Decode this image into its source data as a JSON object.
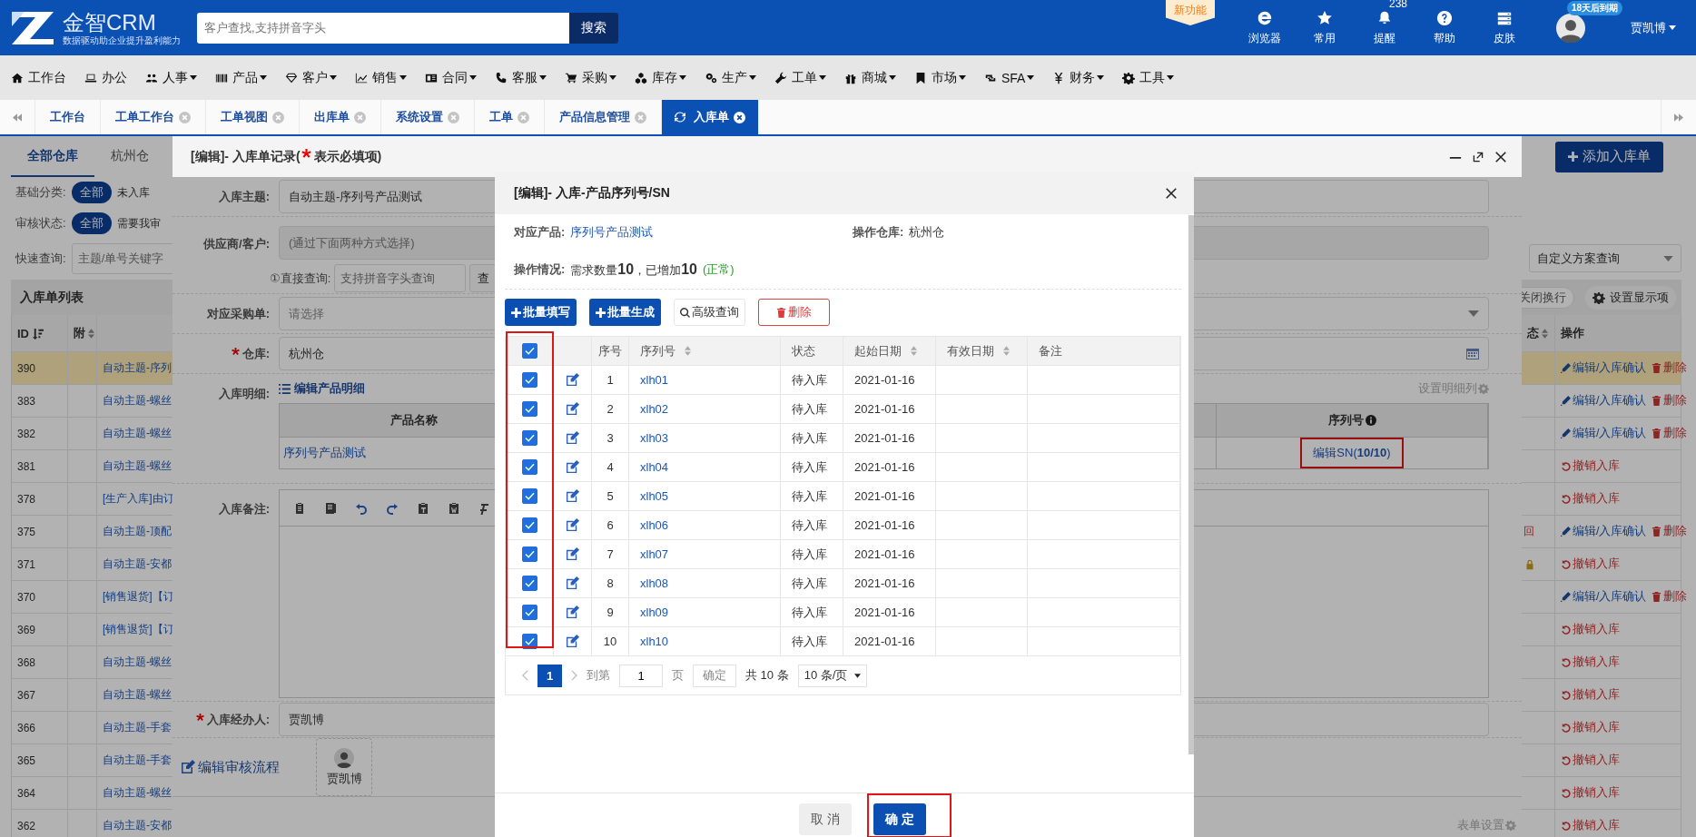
{
  "header": {
    "brand": "金智CRM",
    "tagline": "数据驱动助企业提升盈利能力",
    "search": {
      "placeholder": "客户查找,支持拼音字头"
    },
    "search_button": "搜索",
    "new_feature_badge": "新功能",
    "tools": [
      {
        "label": "浏览器"
      },
      {
        "label": "常用"
      },
      {
        "label": "提醒",
        "badge": "238"
      },
      {
        "label": "帮助"
      },
      {
        "label": "皮肤"
      }
    ],
    "user": {
      "expiry_badge": "18天后到期",
      "name": "贾凯博"
    }
  },
  "menu": [
    {
      "label": "工作台",
      "dropdown": false
    },
    {
      "label": "办公",
      "dropdown": false
    },
    {
      "label": "人事",
      "dropdown": true
    },
    {
      "label": "产品",
      "dropdown": true
    },
    {
      "label": "客户",
      "dropdown": true
    },
    {
      "label": "销售",
      "dropdown": true
    },
    {
      "label": "合同",
      "dropdown": true
    },
    {
      "label": "客服",
      "dropdown": true
    },
    {
      "label": "采购",
      "dropdown": true
    },
    {
      "label": "库存",
      "dropdown": true
    },
    {
      "label": "生产",
      "dropdown": true
    },
    {
      "label": "工单",
      "dropdown": true
    },
    {
      "label": "商城",
      "dropdown": true
    },
    {
      "label": "市场",
      "dropdown": true
    },
    {
      "label": "SFA",
      "dropdown": true
    },
    {
      "label": "财务",
      "dropdown": true
    },
    {
      "label": "工具",
      "dropdown": true
    }
  ],
  "tabs": [
    {
      "label": "工作台",
      "closable": false,
      "selected": false
    },
    {
      "label": "工单工作台",
      "closable": true,
      "selected": false
    },
    {
      "label": "工单视图",
      "closable": true,
      "selected": false
    },
    {
      "label": "出库单",
      "closable": true,
      "selected": false
    },
    {
      "label": "系统设置",
      "closable": true,
      "selected": false
    },
    {
      "label": "工单",
      "closable": true,
      "selected": false
    },
    {
      "label": "产品信息管理",
      "closable": true,
      "selected": false
    },
    {
      "label": "入库单",
      "closable": true,
      "selected": true
    }
  ],
  "page": {
    "warehouse_tabs": [
      {
        "label": "全部仓库",
        "selected": true
      },
      {
        "label": "杭州仓",
        "selected": false
      }
    ],
    "add_button": "添加入库单",
    "filters": [
      {
        "label": "基础分类:",
        "options": [
          {
            "label": "全部",
            "selected": true
          },
          {
            "label": "未入库",
            "selected": false
          }
        ]
      },
      {
        "label": "审核状态:",
        "options": [
          {
            "label": "全部",
            "selected": true
          },
          {
            "label": "需要我审",
            "selected": false
          }
        ]
      }
    ],
    "quick_search": {
      "label": "快速查询:",
      "placeholder": "主题/单号关键字"
    },
    "custom_query": {
      "value": "自定义方案查询"
    },
    "list_title": "入库单列表",
    "wrap_toggle": {
      "label": "关闭换行",
      "on": false
    },
    "display_settings_button": "设置显示项",
    "columns": [
      {
        "label": "ID",
        "sortable": true,
        "sorted_descending": true
      },
      {
        "label": "附",
        "sortable": true,
        "sorted_descending": false
      },
      {
        "label": "态",
        "sortable": true,
        "sorted_descending": false
      },
      {
        "label": "操作",
        "sortable": false,
        "sorted_descending": false
      }
    ],
    "rows": [
      {
        "id": "390",
        "subject": "自动主题-序列",
        "selected": true,
        "locked": false,
        "actions": [
          {
            "kind": "edit",
            "label": "编辑/入库确认"
          },
          {
            "kind": "delete",
            "label": "删除"
          }
        ]
      },
      {
        "id": "383",
        "subject": "自动主题-螺丝",
        "selected": false,
        "locked": false,
        "actions": [
          {
            "kind": "edit",
            "label": "编辑/入库确认"
          },
          {
            "kind": "delete",
            "label": "删除"
          }
        ]
      },
      {
        "id": "382",
        "subject": "自动主题-螺丝",
        "selected": false,
        "locked": false,
        "actions": [
          {
            "kind": "edit",
            "label": "编辑/入库确认"
          },
          {
            "kind": "delete",
            "label": "删除"
          }
        ]
      },
      {
        "id": "381",
        "subject": "自动主题-螺丝",
        "selected": false,
        "locked": false,
        "actions": [
          {
            "kind": "revoke",
            "label": "撤销入库"
          }
        ]
      },
      {
        "id": "378",
        "subject": "[生产入库]由订",
        "selected": false,
        "locked": false,
        "actions": [
          {
            "kind": "revoke",
            "label": "撤销入库"
          }
        ]
      },
      {
        "id": "375",
        "subject": "自动主题-顶配",
        "status": "回",
        "selected": false,
        "locked": false,
        "actions": [
          {
            "kind": "edit",
            "label": "编辑/入库确认"
          },
          {
            "kind": "delete",
            "label": "删除"
          }
        ]
      },
      {
        "id": "371",
        "subject": "自动主题-安都",
        "selected": false,
        "locked": true,
        "actions": [
          {
            "kind": "revoke",
            "label": "撤销入库"
          }
        ]
      },
      {
        "id": "370",
        "subject": "[销售退货]【订",
        "selected": false,
        "locked": false,
        "actions": [
          {
            "kind": "edit",
            "label": "编辑/入库确认"
          },
          {
            "kind": "delete",
            "label": "删除"
          }
        ]
      },
      {
        "id": "369",
        "subject": "[销售退货]【订",
        "selected": false,
        "locked": false,
        "actions": [
          {
            "kind": "revoke",
            "label": "撤销入库"
          }
        ]
      },
      {
        "id": "368",
        "subject": "自动主题-螺丝",
        "selected": false,
        "locked": false,
        "actions": [
          {
            "kind": "revoke",
            "label": "撤销入库"
          }
        ]
      },
      {
        "id": "367",
        "subject": "自动主题-螺丝",
        "selected": false,
        "locked": false,
        "actions": [
          {
            "kind": "revoke",
            "label": "撤销入库"
          }
        ]
      },
      {
        "id": "366",
        "subject": "自动主题-手套",
        "selected": false,
        "locked": false,
        "actions": [
          {
            "kind": "revoke",
            "label": "撤销入库"
          }
        ]
      },
      {
        "id": "365",
        "subject": "自动主题-手套",
        "selected": false,
        "locked": false,
        "actions": [
          {
            "kind": "revoke",
            "label": "撤销入库"
          }
        ]
      },
      {
        "id": "364",
        "subject": "自动主题-螺丝",
        "selected": false,
        "locked": false,
        "actions": [
          {
            "kind": "revoke",
            "label": "撤销入库"
          }
        ]
      },
      {
        "id": "362",
        "subject": "自动主题-安都",
        "selected": false,
        "locked": false,
        "actions": [
          {
            "kind": "revoke",
            "label": "撤销入库"
          }
        ]
      }
    ]
  },
  "record_dialog": {
    "title": "[编辑]- 入库单记录(",
    "title_note": "表示必填项)",
    "subject": {
      "label": "入库主题:",
      "required": false,
      "value": "自动主题-序列号产品测试"
    },
    "supplier": {
      "label": "供应商/客户:",
      "required": false,
      "placeholder": "(通过下面两种方式选择)"
    },
    "direct_query": {
      "label": "①直接查询:",
      "placeholder": "支持拼音字头查询",
      "button": "查"
    },
    "purchase_order": {
      "label": "对应采购单:",
      "required": false,
      "placeholder": "请选择"
    },
    "warehouse": {
      "label": "仓库:",
      "required": true,
      "value": "杭州仓"
    },
    "details": {
      "label": "入库明细:",
      "edit_link": "编辑产品明细",
      "settings_link": "设置明细列",
      "columns": [
        "产品名称",
        "序列号"
      ],
      "rows": [
        {
          "product": "序列号产品测试",
          "sn_link": "编辑SN(**10/10**)",
          "highlighted": true
        }
      ]
    },
    "remark": {
      "label": "入库备注:"
    },
    "handler": {
      "label": "入库经办人:",
      "required": true,
      "value": "贾凯博"
    },
    "approval": {
      "link": "编辑审核流程",
      "approver": "贾凯博"
    },
    "form_settings": "表单设置"
  },
  "sn_dialog": {
    "title": "[编辑]- 入库-产品序列号/SN",
    "product": {
      "label": "对应产品:",
      "value": "序列号产品测试"
    },
    "warehouse": {
      "label": "操作仓库:",
      "value": "杭州仓"
    },
    "status": {
      "label": "操作情况:",
      "text": "需求数量**10**，已增加**10**",
      "note": "(正常)"
    },
    "buttons": [
      {
        "kind": "primary",
        "label": "批量填写"
      },
      {
        "kind": "primary",
        "label": "批量生成"
      },
      {
        "kind": "search",
        "label": "高级查询"
      },
      {
        "kind": "danger",
        "label": "删除"
      }
    ],
    "all_checked": true,
    "checkbox_column_highlighted": true,
    "columns": [
      {
        "label": "序号",
        "sortable": false
      },
      {
        "label": "序列号",
        "sortable": true
      },
      {
        "label": "状态",
        "sortable": false
      },
      {
        "label": "起始日期",
        "sortable": true
      },
      {
        "label": "有效日期",
        "sortable": true
      },
      {
        "label": "备注",
        "sortable": false
      }
    ],
    "rows": [
      {
        "no": "1",
        "serial": "xlh01",
        "status": "待入库",
        "start_date": "2021-01-16",
        "checked": true
      },
      {
        "no": "2",
        "serial": "xlh02",
        "status": "待入库",
        "start_date": "2021-01-16",
        "checked": true
      },
      {
        "no": "3",
        "serial": "xlh03",
        "status": "待入库",
        "start_date": "2021-01-16",
        "checked": true
      },
      {
        "no": "4",
        "serial": "xlh04",
        "status": "待入库",
        "start_date": "2021-01-16",
        "checked": true
      },
      {
        "no": "5",
        "serial": "xlh05",
        "status": "待入库",
        "start_date": "2021-01-16",
        "checked": true
      },
      {
        "no": "6",
        "serial": "xlh06",
        "status": "待入库",
        "start_date": "2021-01-16",
        "checked": true
      },
      {
        "no": "7",
        "serial": "xlh07",
        "status": "待入库",
        "start_date": "2021-01-16",
        "checked": true
      },
      {
        "no": "8",
        "serial": "xlh08",
        "status": "待入库",
        "start_date": "2021-01-16",
        "checked": true
      },
      {
        "no": "9",
        "serial": "xlh09",
        "status": "待入库",
        "start_date": "2021-01-16",
        "checked": true
      },
      {
        "no": "10",
        "serial": "xlh10",
        "status": "待入库",
        "start_date": "2021-01-16",
        "checked": true
      }
    ],
    "pagination": {
      "current": "1",
      "goto_label": "到第",
      "goto_value": "1",
      "page_unit": "页",
      "confirm": "确定",
      "total": "共 10 条",
      "page_size": "10 条/页"
    },
    "cancel": "取 消",
    "ok": "确 定",
    "ok_highlighted": true
  }
}
